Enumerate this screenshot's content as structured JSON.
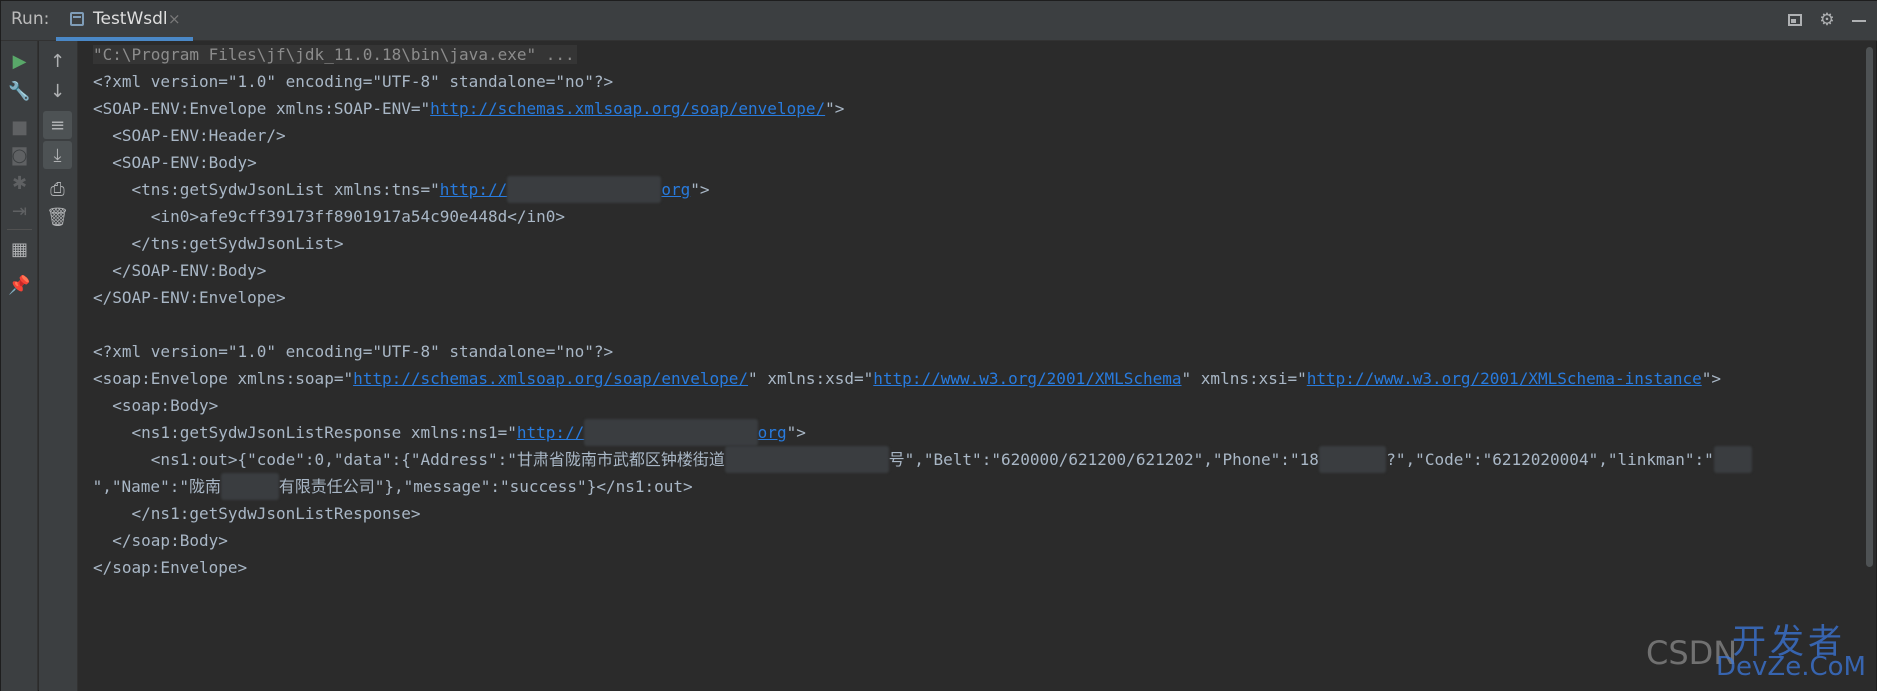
{
  "header": {
    "run_label": "Run:",
    "tab_title": "TestWsdl",
    "tab_close": "×",
    "right_icons": [
      "restore-layout-icon",
      "gear-icon",
      "minimize-icon"
    ]
  },
  "toolbar_left": [
    "run-icon",
    "wrench-icon",
    "stop-icon",
    "camera-icon",
    "debug-icon",
    "exit-icon",
    "layout-icon",
    "pin-icon"
  ],
  "toolbar_right": [
    "arrow-up-icon",
    "arrow-down-icon",
    "soft-wrap-icon",
    "scroll-to-end-icon",
    "print-icon",
    "trash-icon"
  ],
  "console": {
    "cmd": "\"C:\\Program Files\\jf\\jdk_11.0.18\\bin\\java.exe\" ...",
    "req": {
      "xmldecl": "<?xml version=\"1.0\" encoding=\"UTF-8\" standalone=\"no\"?>",
      "env_open_pre": "<SOAP-ENV:Envelope xmlns:SOAP-ENV=\"",
      "env_ns_link": "http://schemas.xmlsoap.org/soap/envelope/",
      "env_open_post": "\">",
      "header": "  <SOAP-ENV:Header/>",
      "body_open": "  <SOAP-ENV:Body>",
      "tns_pre": "    <tns:getSydwJsonList xmlns:tns=\"",
      "tns_link_start": "http://",
      "tns_link_end": "org",
      "tns_post": "\">",
      "in0": "      <in0>afe9cff39173ff8901917a54c90e448d</in0>",
      "tns_close": "    </tns:getSydwJsonList>",
      "body_close": "  </SOAP-ENV:Body>",
      "env_close": "</SOAP-ENV:Envelope>"
    },
    "resp": {
      "xmldecl": "<?xml version=\"1.0\" encoding=\"UTF-8\" standalone=\"no\"?>",
      "env_pre": "<soap:Envelope xmlns:soap=\"",
      "soap_link": "http://schemas.xmlsoap.org/soap/envelope/",
      "xsd_pre": "\" xmlns:xsd=\"",
      "xsd_link": "http://www.w3.org/2001/XMLSchema",
      "xsi_pre": "\" xmlns:xsi=\"",
      "xsi_link": "http://www.w3.org/2001/XMLSchema-instance",
      "env_post": "\">",
      "body_open": "  <soap:Body>",
      "ns1_pre": "    <ns1:getSydwJsonListResponse xmlns:ns1=\"",
      "ns1_link_start": "http://",
      "ns1_link_end": "org",
      "ns1_post": "\">",
      "out_a": "      <ns1:out>{\"code\":0,\"data\":{\"Address\":\"甘肃省陇南市武都区钟楼街道",
      "out_b": "号\",\"Belt\":\"620000/621200/621202\",\"Phone\":\"18",
      "out_c": "?\",\"Code\":\"6212020004\",\"linkman\":\"",
      "out2_a": " \",\"Name\":\"陇南",
      "out2_b": "有限责任公司\"},\"message\":\"success\"}</ns1:out>",
      "ns1_close": "    </ns1:getSydwJsonListResponse>",
      "body_close": "  </soap:Body>",
      "env_close": "</soap:Envelope>"
    }
  },
  "watermark": {
    "csdn": "CSDN",
    "cn": "开发者",
    "en": "DevZe.CoM"
  }
}
